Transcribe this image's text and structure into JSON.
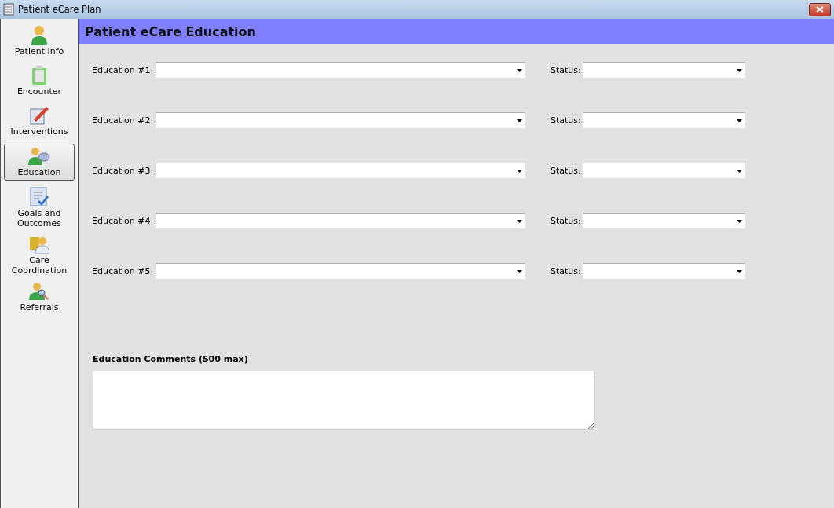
{
  "window": {
    "title": "Patient eCare Plan"
  },
  "sidebar": {
    "items": [
      {
        "label": "Patient Info",
        "selected": false
      },
      {
        "label": "Encounter",
        "selected": false
      },
      {
        "label": "Interventions",
        "selected": false
      },
      {
        "label": "Education",
        "selected": true
      },
      {
        "label": "Goals and Outcomes",
        "selected": false
      },
      {
        "label": "Care Coordination",
        "selected": false
      },
      {
        "label": "Referrals",
        "selected": false
      }
    ]
  },
  "header": {
    "title": "Patient eCare Education"
  },
  "rows": [
    {
      "label": "Education #1:",
      "status_label": "Status:"
    },
    {
      "label": "Education #2:",
      "status_label": "Status:"
    },
    {
      "label": "Education #3:",
      "status_label": "Status:"
    },
    {
      "label": "Education #4:",
      "status_label": "Status:"
    },
    {
      "label": "Education #5:",
      "status_label": "Status:"
    }
  ],
  "comments": {
    "label": "Education Comments (500 max)"
  }
}
